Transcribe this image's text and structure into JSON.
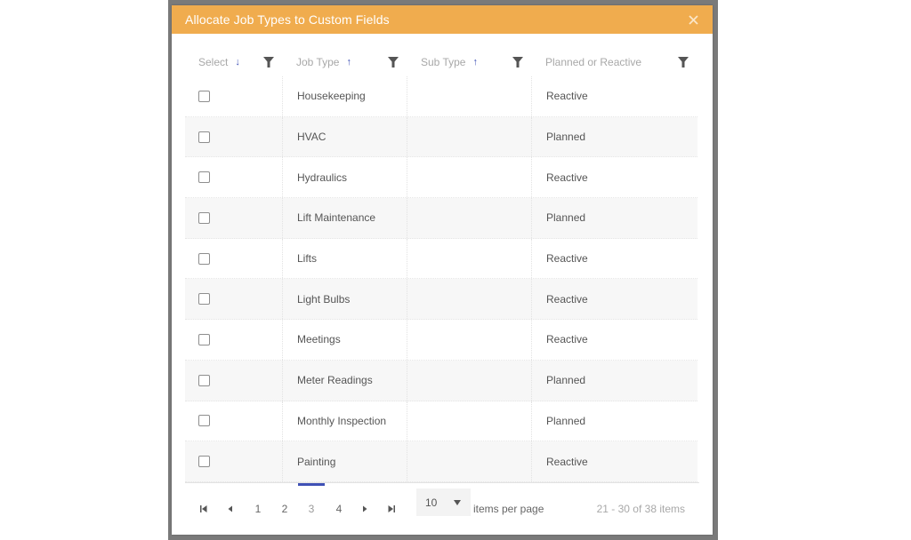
{
  "dialog": {
    "title": "Allocate Job Types to Custom Fields",
    "close_icon": "close-icon",
    "header_color": "#f0ac4e"
  },
  "columns": [
    {
      "label": "Select",
      "sort": "descending",
      "sort_icon": "arrow-down-icon",
      "filter_icon": "filter-icon"
    },
    {
      "label": "Job Type",
      "sort": "ascending",
      "sort_icon": "arrow-up-icon",
      "filter_icon": "filter-icon"
    },
    {
      "label": "Sub Type",
      "sort": "ascending",
      "sort_icon": "arrow-up-icon",
      "filter_icon": "filter-icon"
    },
    {
      "label": "Planned or Reactive",
      "sort": "none",
      "filter_icon": "filter-icon"
    }
  ],
  "rows": [
    {
      "checked": false,
      "job_type": "Housekeeping",
      "sub_type": "",
      "planned_or_reactive": "Reactive"
    },
    {
      "checked": false,
      "job_type": "HVAC",
      "sub_type": "",
      "planned_or_reactive": "Planned"
    },
    {
      "checked": false,
      "job_type": "Hydraulics",
      "sub_type": "",
      "planned_or_reactive": "Reactive"
    },
    {
      "checked": false,
      "job_type": "Lift Maintenance",
      "sub_type": "",
      "planned_or_reactive": "Planned"
    },
    {
      "checked": false,
      "job_type": "Lifts",
      "sub_type": "",
      "planned_or_reactive": "Reactive"
    },
    {
      "checked": false,
      "job_type": "Light Bulbs",
      "sub_type": "",
      "planned_or_reactive": "Reactive"
    },
    {
      "checked": false,
      "job_type": "Meetings",
      "sub_type": "",
      "planned_or_reactive": "Reactive"
    },
    {
      "checked": false,
      "job_type": "Meter Readings",
      "sub_type": "",
      "planned_or_reactive": "Planned"
    },
    {
      "checked": false,
      "job_type": "Monthly Inspection",
      "sub_type": "",
      "planned_or_reactive": "Planned"
    },
    {
      "checked": false,
      "job_type": "Painting",
      "sub_type": "",
      "planned_or_reactive": "Reactive"
    }
  ],
  "pager": {
    "pages": [
      "1",
      "2",
      "3",
      "4"
    ],
    "current_page": "3",
    "page_size": "10",
    "items_per_page_label": "items per page",
    "info": "21 - 30 of 38 items",
    "accent_color": "#3f51b5"
  }
}
